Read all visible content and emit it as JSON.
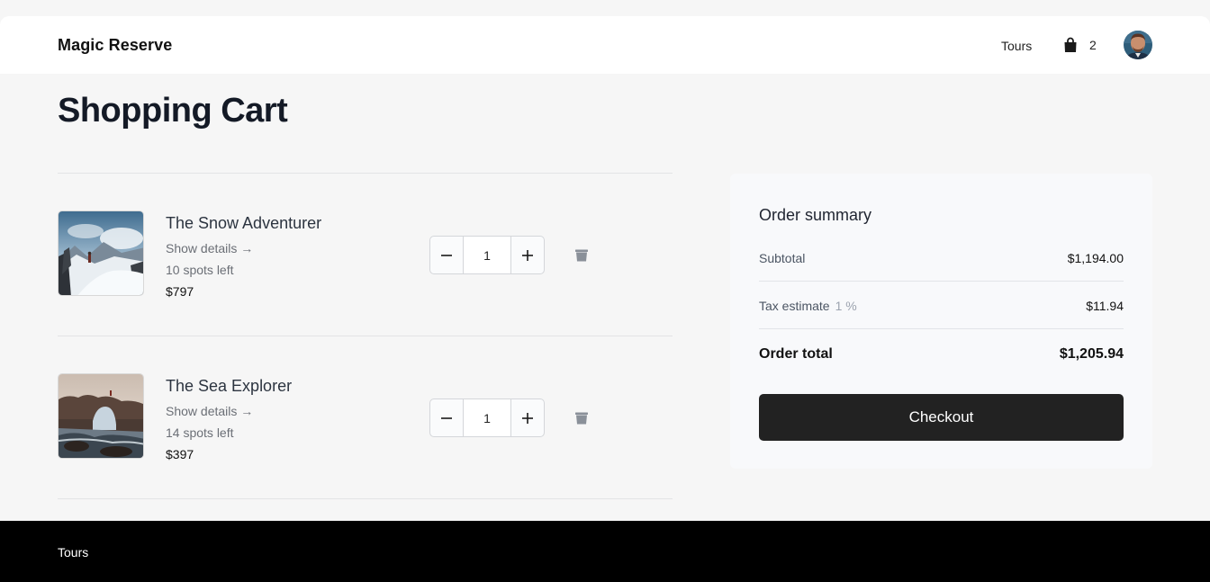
{
  "header": {
    "brand": "Magic Reserve",
    "nav_tours": "Tours",
    "cart_count": "2",
    "icons": {
      "cart": "shopping-bag-icon",
      "avatar": "user-avatar"
    }
  },
  "page": {
    "title": "Shopping Cart"
  },
  "cart": {
    "items": [
      {
        "name": "The Snow Adventurer",
        "details_link": "Show details →",
        "spots": "10 spots left",
        "price": "$797",
        "quantity": "1",
        "image": "snowy-mountain-hiker"
      },
      {
        "name": "The Sea Explorer",
        "details_link": "Show details →",
        "spots": "14 spots left",
        "price": "$397",
        "quantity": "1",
        "image": "sea-rock-arch"
      }
    ]
  },
  "summary": {
    "title": "Order summary",
    "subtotal_label": "Subtotal",
    "subtotal_value": "$1,194.00",
    "tax_label": "Tax estimate",
    "tax_rate": "1 %",
    "tax_value": "$11.94",
    "total_label": "Order total",
    "total_value": "$1,205.94",
    "checkout_label": "Checkout"
  },
  "footer": {
    "tours": "Tours"
  },
  "colors": {
    "checkout_bg": "#222222",
    "footer_bg": "#000000",
    "page_bg": "#f6f6f6"
  }
}
